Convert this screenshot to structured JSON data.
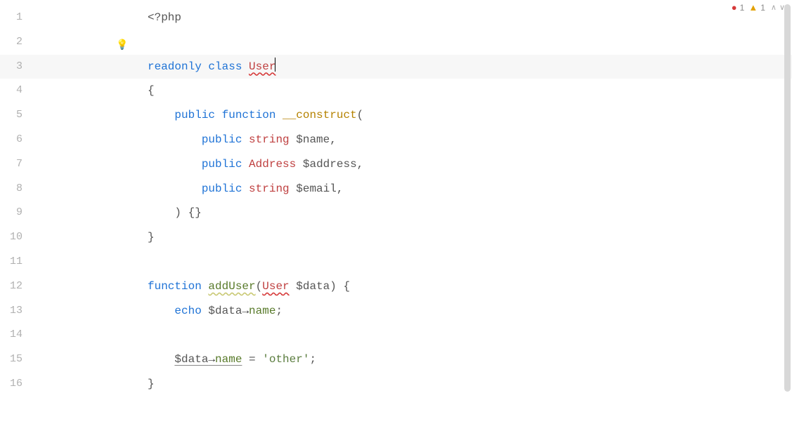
{
  "status": {
    "error_count": "1",
    "warning_count": "1"
  },
  "bulb": "💡",
  "lines": {
    "count": 16
  },
  "code": {
    "l1": {
      "open": "<?php"
    },
    "l3": {
      "readonly": "readonly",
      "class": "class",
      "user": "User"
    },
    "l4": {
      "brace": "{"
    },
    "l5": {
      "public": "public",
      "function": "function",
      "construct": "__construct",
      "paren": "("
    },
    "l6": {
      "public": "public",
      "type": "string",
      "var": "$name",
      "comma": ","
    },
    "l7": {
      "public": "public",
      "type": "Address",
      "var": "$address",
      "comma": ","
    },
    "l8": {
      "public": "public",
      "type": "string",
      "var": "$email",
      "comma": ","
    },
    "l9": {
      "close": ") {}"
    },
    "l10": {
      "brace": "}"
    },
    "l12": {
      "function": "function",
      "name": "addUser",
      "paren_open": "(",
      "type": "User",
      "var": "$data",
      "paren_close": ") {"
    },
    "l13": {
      "echo": "echo",
      "var": "$data",
      "arrow": "→",
      "prop": "name",
      "semi": ";"
    },
    "l15": {
      "var": "$data",
      "arrow": "→",
      "prop": "name",
      "eq": " = ",
      "str": "'other'",
      "semi": ";"
    },
    "l16": {
      "brace": "}"
    }
  }
}
